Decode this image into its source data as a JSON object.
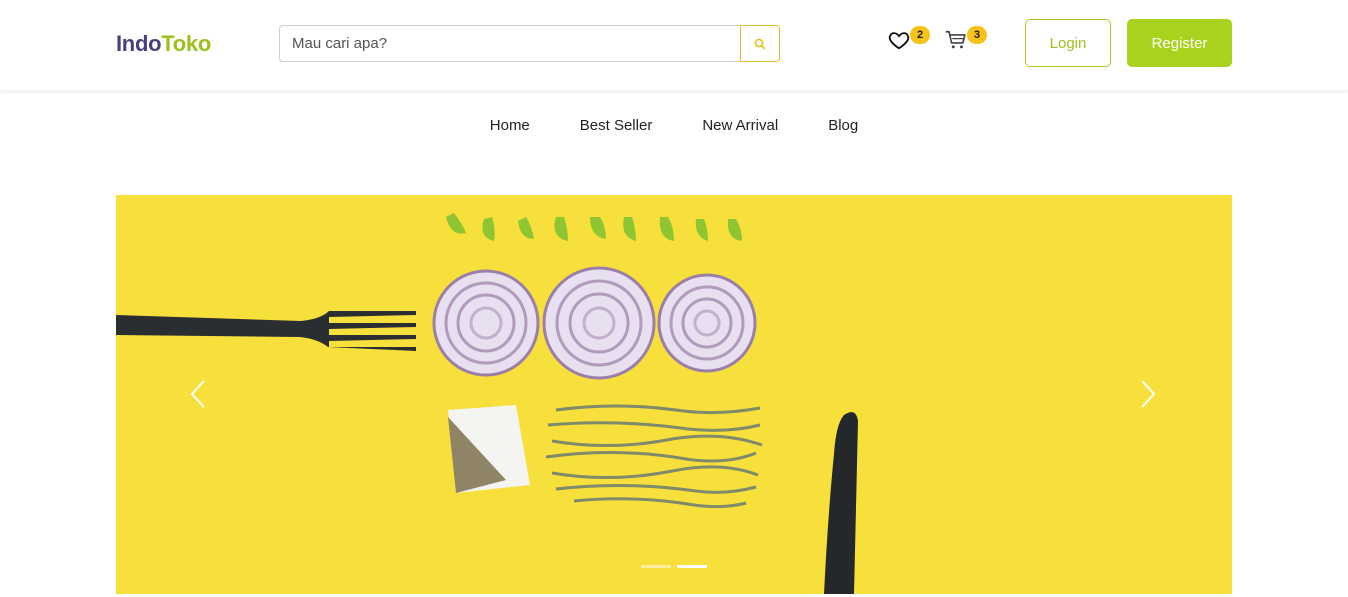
{
  "brand": {
    "part1": "Indo",
    "part2": "Toko"
  },
  "search": {
    "placeholder": "Mau cari apa?",
    "value": "",
    "icon": "search-icon"
  },
  "header": {
    "wishlist": {
      "icon": "heart-icon",
      "count": "2"
    },
    "cart": {
      "icon": "cart-icon",
      "count": "3"
    },
    "login_label": "Login",
    "register_label": "Register"
  },
  "nav": {
    "items": [
      "Home",
      "Best Seller",
      "New Arrival",
      "Blog"
    ]
  },
  "hero": {
    "image": "food-flatlay-yellow-background",
    "prev_icon": "chevron-left-icon",
    "next_icon": "chevron-right-icon",
    "slides_total": 2,
    "active_slide": 2
  },
  "colors": {
    "brand_dark": "#4a3f7a",
    "brand_green": "#9bc21c",
    "badge": "#f7c31b",
    "hero_bg": "#f7df3c"
  }
}
